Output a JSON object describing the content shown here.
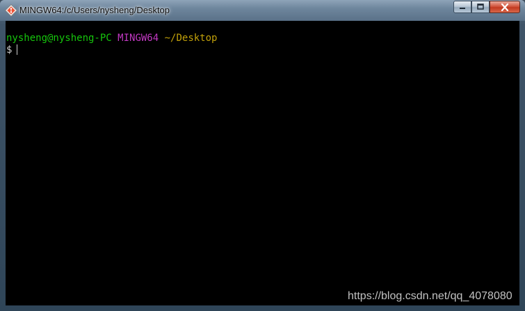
{
  "window": {
    "title": "MINGW64:/c/Users/nysheng/Desktop",
    "app_icon": "git-icon"
  },
  "controls": {
    "minimize_icon": "minimize-icon",
    "maximize_icon": "maximize-icon",
    "close_icon": "close-icon"
  },
  "terminal": {
    "user_host": "nysheng@nysheng-PC",
    "system": "MINGW64",
    "cwd": "~/Desktop",
    "prompt_symbol": "$",
    "colors": {
      "background": "#000000",
      "user_host": "#16c60c",
      "system": "#c239c2",
      "cwd": "#c1a00a"
    }
  },
  "watermark": "https://blog.csdn.net/qq_4078080"
}
